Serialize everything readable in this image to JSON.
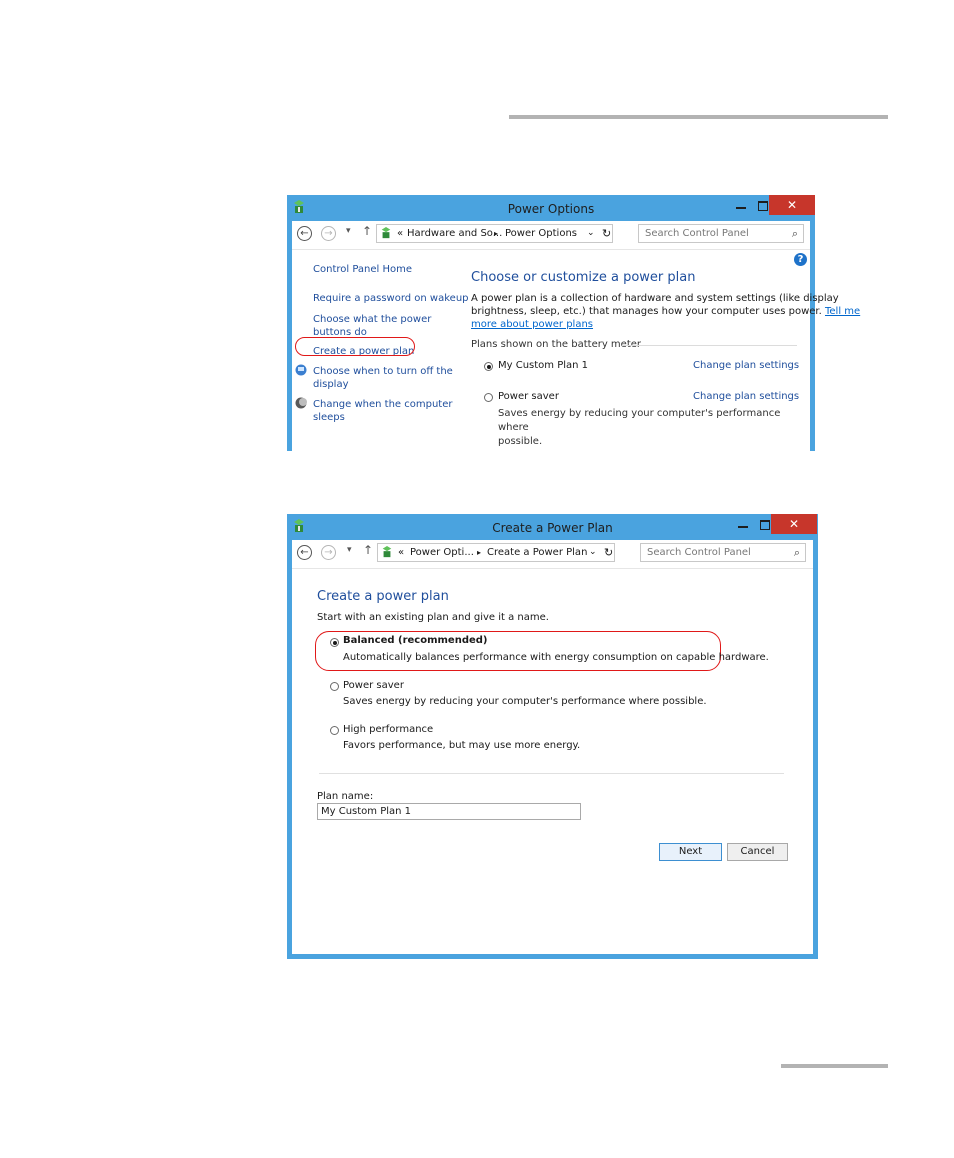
{
  "window1": {
    "title": "Power Options",
    "close_glyph": "✕",
    "breadcrumb": {
      "prefix": "«",
      "parent": "Hardware and So...",
      "separator": "▸",
      "current": "Power Options"
    },
    "search_placeholder": "Search Control Panel",
    "help_glyph": "?",
    "sidebar": {
      "home": "Control Panel Home",
      "items": [
        "Require a password on wakeup",
        "Choose what the power",
        "buttons do",
        "Create a power plan",
        "Choose when to turn off the",
        "display",
        "Change when the computer",
        "sleeps"
      ]
    },
    "main": {
      "heading": "Choose or customize a power plan",
      "desc_line1": "A power plan is a collection of hardware and system settings (like display",
      "desc_line2": "brightness, sleep, etc.) that manages how your computer uses power.",
      "tell_me": "Tell me",
      "learn_more": "more about power plans",
      "section_label": "Plans shown on the battery meter",
      "plans": [
        {
          "name": "My Custom Plan 1",
          "selected": true,
          "action": "Change plan settings",
          "desc1": "",
          "desc2": ""
        },
        {
          "name": "Power saver",
          "selected": false,
          "action": "Change plan settings",
          "desc1": "Saves energy by reducing your computer's performance where",
          "desc2": "possible."
        }
      ]
    }
  },
  "window2": {
    "title": "Create a Power Plan",
    "close_glyph": "✕",
    "breadcrumb": {
      "prefix": "«",
      "parent": "Power Opti...",
      "separator": "▸",
      "current": "Create a Power Plan"
    },
    "search_placeholder": "Search Control Panel",
    "heading": "Create a power plan",
    "subheading": "Start with an existing plan and give it a name.",
    "plans": [
      {
        "name": "Balanced (recommended)",
        "desc": "Automatically balances performance with energy consumption on capable hardware.",
        "selected": true
      },
      {
        "name": "Power saver",
        "desc": "Saves energy by reducing your computer's performance where possible.",
        "selected": false
      },
      {
        "name": "High performance",
        "desc": "Favors performance, but may use more energy.",
        "selected": false
      }
    ],
    "plan_name_label": "Plan name:",
    "plan_name_value": "My Custom Plan 1",
    "next_label": "Next",
    "cancel_label": "Cancel"
  },
  "colors": {
    "window_frame": "#4aa3df",
    "close_button": "#c7362b",
    "highlight_oval": "#e01818",
    "link": "#1f4e9c"
  },
  "icons": [
    "power-options-icon",
    "back-arrow-icon",
    "forward-arrow-icon",
    "up-arrow-icon",
    "refresh-icon",
    "search-icon",
    "help-icon",
    "display-icon",
    "sleep-icon"
  ]
}
